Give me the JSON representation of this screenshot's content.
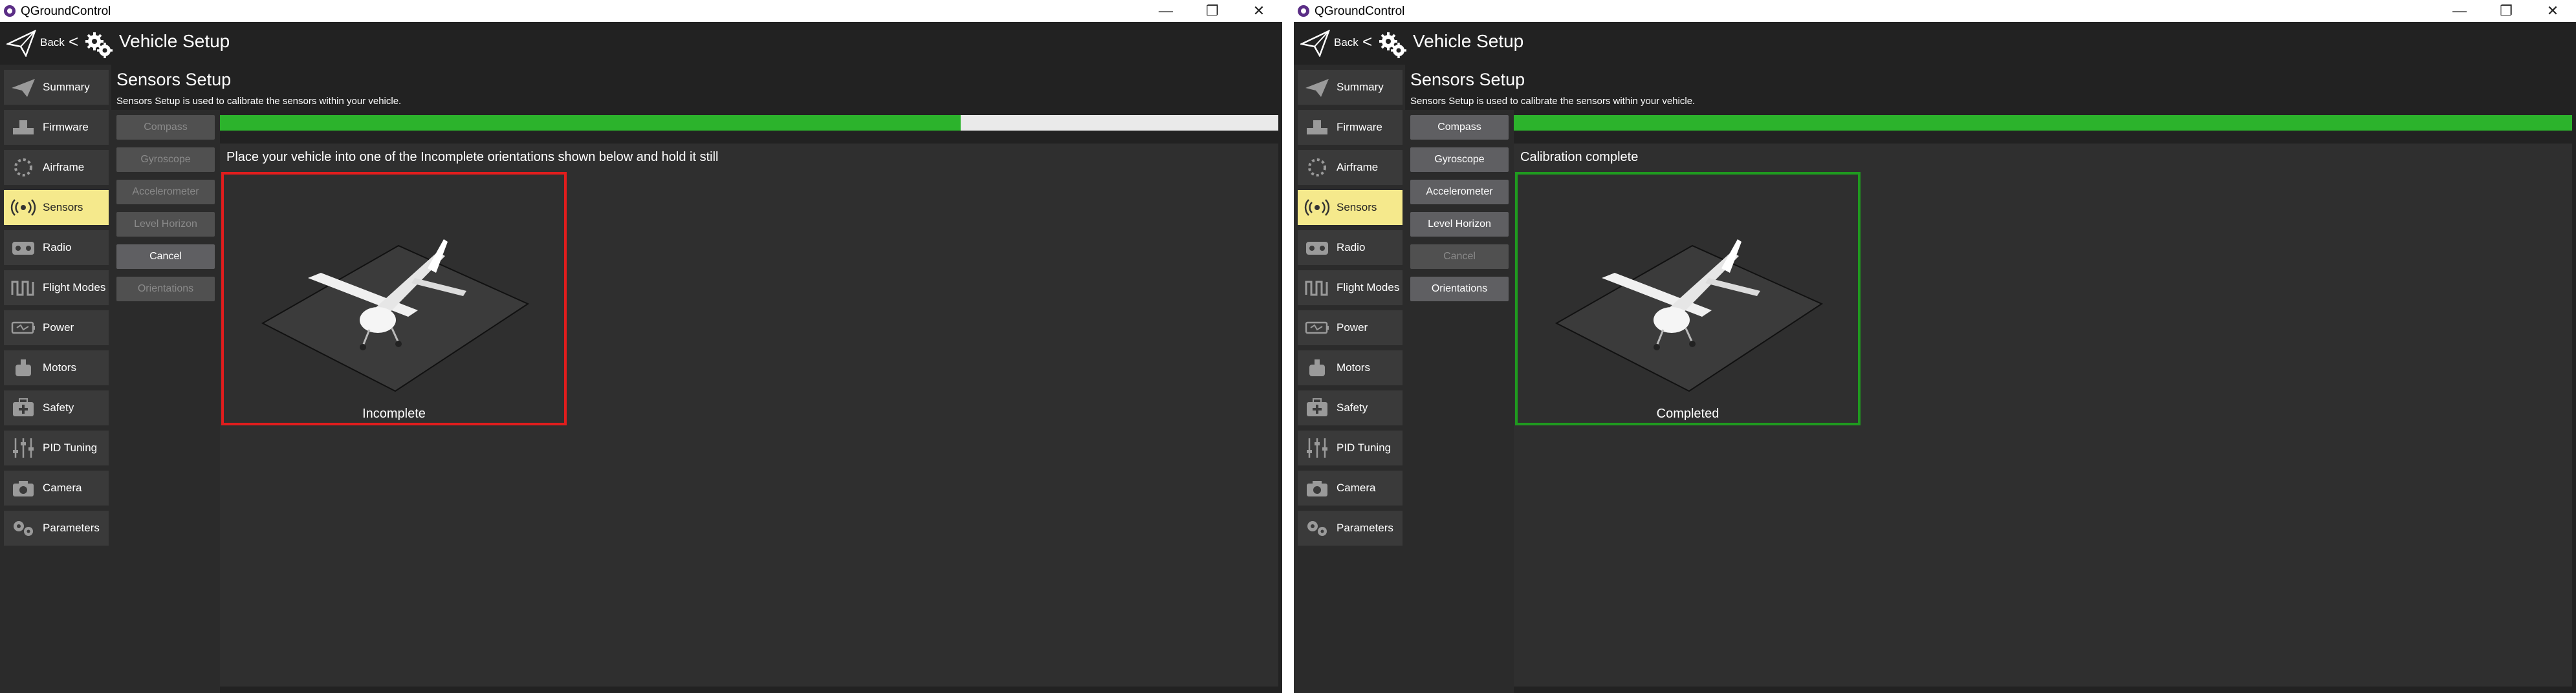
{
  "colors": {
    "accent_active": "#f5e98c",
    "progress_fill": "#2cb32c",
    "incomplete_border": "#e11d1d",
    "complete_border": "#1f9a1f",
    "background": "#222222"
  },
  "windows": [
    {
      "app_title": "QGroundControl",
      "toolbar": {
        "back_label": "Back",
        "separator": "<",
        "title": "Vehicle Setup"
      },
      "sidebar": {
        "items": [
          {
            "label": "Summary",
            "icon": "paper-plane-icon",
            "active": false
          },
          {
            "label": "Firmware",
            "icon": "firmware-icon",
            "active": false
          },
          {
            "label": "Airframe",
            "icon": "airframe-icon",
            "active": false
          },
          {
            "label": "Sensors",
            "icon": "sensors-icon",
            "active": true
          },
          {
            "label": "Radio",
            "icon": "radio-icon",
            "active": false
          },
          {
            "label": "Flight Modes",
            "icon": "flight-modes-icon",
            "active": false
          },
          {
            "label": "Power",
            "icon": "power-icon",
            "active": false
          },
          {
            "label": "Motors",
            "icon": "motors-icon",
            "active": false
          },
          {
            "label": "Safety",
            "icon": "safety-icon",
            "active": false
          },
          {
            "label": "PID Tuning",
            "icon": "pid-tuning-icon",
            "active": false
          },
          {
            "label": "Camera",
            "icon": "camera-icon",
            "active": false
          },
          {
            "label": "Parameters",
            "icon": "parameters-icon",
            "active": false
          }
        ]
      },
      "sensors": {
        "title": "Sensors Setup",
        "subtitle": "Sensors Setup is used to calibrate the sensors within your vehicle.",
        "buttons": [
          {
            "label": "Compass",
            "enabled": false
          },
          {
            "label": "Gyroscope",
            "enabled": false
          },
          {
            "label": "Accelerometer",
            "enabled": false
          },
          {
            "label": "Level Horizon",
            "enabled": false
          },
          {
            "label": "Cancel",
            "enabled": true
          },
          {
            "label": "Orientations",
            "enabled": false
          }
        ],
        "progress": 0.7,
        "instruction": "Place your vehicle into one of the Incomplete orientations shown below and hold it still",
        "orientation_status": "Incomplete",
        "status_kind": "incomplete"
      }
    },
    {
      "app_title": "QGroundControl",
      "toolbar": {
        "back_label": "Back",
        "separator": "<",
        "title": "Vehicle Setup"
      },
      "sidebar": {
        "items": [
          {
            "label": "Summary",
            "icon": "paper-plane-icon",
            "active": false
          },
          {
            "label": "Firmware",
            "icon": "firmware-icon",
            "active": false
          },
          {
            "label": "Airframe",
            "icon": "airframe-icon",
            "active": false
          },
          {
            "label": "Sensors",
            "icon": "sensors-icon",
            "active": true
          },
          {
            "label": "Radio",
            "icon": "radio-icon",
            "active": false
          },
          {
            "label": "Flight Modes",
            "icon": "flight-modes-icon",
            "active": false
          },
          {
            "label": "Power",
            "icon": "power-icon",
            "active": false
          },
          {
            "label": "Motors",
            "icon": "motors-icon",
            "active": false
          },
          {
            "label": "Safety",
            "icon": "safety-icon",
            "active": false
          },
          {
            "label": "PID Tuning",
            "icon": "pid-tuning-icon",
            "active": false
          },
          {
            "label": "Camera",
            "icon": "camera-icon",
            "active": false
          },
          {
            "label": "Parameters",
            "icon": "parameters-icon",
            "active": false
          }
        ]
      },
      "sensors": {
        "title": "Sensors Setup",
        "subtitle": "Sensors Setup is used to calibrate the sensors within your vehicle.",
        "buttons": [
          {
            "label": "Compass",
            "enabled": true
          },
          {
            "label": "Gyroscope",
            "enabled": true
          },
          {
            "label": "Accelerometer",
            "enabled": true
          },
          {
            "label": "Level Horizon",
            "enabled": true
          },
          {
            "label": "Cancel",
            "enabled": false
          },
          {
            "label": "Orientations",
            "enabled": true
          }
        ],
        "progress": 1.0,
        "instruction": "Calibration complete",
        "orientation_status": "Completed",
        "status_kind": "complete"
      }
    }
  ]
}
